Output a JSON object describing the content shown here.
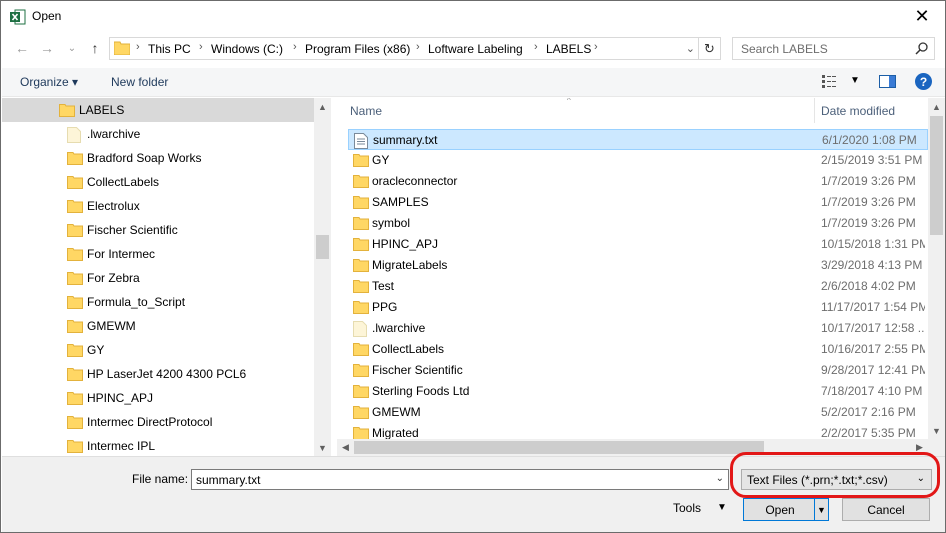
{
  "window": {
    "title": "Open",
    "app_icon": "excel-icon",
    "close_glyph": "✕"
  },
  "nav_buttons": {
    "back": "←",
    "forward": "→",
    "recent": "⌄",
    "up": "↑"
  },
  "address": {
    "crumbs": [
      "This PC",
      "Windows (C:)",
      "Program Files (x86)",
      "Loftware Labeling",
      "LABELS"
    ],
    "separator": "›",
    "refresh": "↻"
  },
  "search": {
    "placeholder": "Search LABELS"
  },
  "toolbar": {
    "organize": "Organize ▾",
    "new_folder": "New folder",
    "help": "?"
  },
  "nav_pane": {
    "items": [
      {
        "label": "LABELS",
        "icon": "folder-icon",
        "selected": true
      },
      {
        "label": ".lwarchive",
        "icon": "file-icon"
      },
      {
        "label": "Bradford Soap Works",
        "icon": "folder-icon"
      },
      {
        "label": "CollectLabels",
        "icon": "folder-icon"
      },
      {
        "label": "Electrolux",
        "icon": "folder-icon"
      },
      {
        "label": "Fischer Scientific",
        "icon": "folder-icon"
      },
      {
        "label": "For Intermec",
        "icon": "folder-icon"
      },
      {
        "label": "For Zebra",
        "icon": "folder-icon"
      },
      {
        "label": "Formula_to_Script",
        "icon": "folder-icon"
      },
      {
        "label": "GMEWM",
        "icon": "folder-icon"
      },
      {
        "label": "GY",
        "icon": "folder-icon"
      },
      {
        "label": "HP LaserJet 4200 4300 PCL6",
        "icon": "folder-icon"
      },
      {
        "label": "HPINC_APJ",
        "icon": "folder-icon"
      },
      {
        "label": "Intermec DirectProtocol",
        "icon": "folder-icon"
      },
      {
        "label": "Intermec IPL",
        "icon": "folder-icon"
      }
    ]
  },
  "file_list": {
    "columns": {
      "name": "Name",
      "date": "Date modified"
    },
    "rows": [
      {
        "name": "summary.txt",
        "date": "6/1/2020 1:08 PM",
        "icon": "text-file-icon",
        "selected": true
      },
      {
        "name": "GY",
        "date": "2/15/2019 3:51 PM",
        "icon": "folder-icon"
      },
      {
        "name": "oracleconnector",
        "date": "1/7/2019 3:26 PM",
        "icon": "folder-icon"
      },
      {
        "name": "SAMPLES",
        "date": "1/7/2019 3:26 PM",
        "icon": "folder-icon"
      },
      {
        "name": "symbol",
        "date": "1/7/2019 3:26 PM",
        "icon": "folder-icon"
      },
      {
        "name": "HPINC_APJ",
        "date": "10/15/2018 1:31 PM",
        "icon": "folder-icon"
      },
      {
        "name": "MigrateLabels",
        "date": "3/29/2018 4:13 PM",
        "icon": "folder-icon"
      },
      {
        "name": "Test",
        "date": "2/6/2018 4:02 PM",
        "icon": "folder-icon"
      },
      {
        "name": "PPG",
        "date": "11/17/2017 1:54 PM",
        "icon": "folder-icon"
      },
      {
        "name": ".lwarchive",
        "date": "10/17/2017 12:58 ...",
        "icon": "file-icon"
      },
      {
        "name": "CollectLabels",
        "date": "10/16/2017 2:55 PM",
        "icon": "folder-icon"
      },
      {
        "name": "Fischer Scientific",
        "date": "9/28/2017 12:41 PM",
        "icon": "folder-icon"
      },
      {
        "name": "Sterling Foods Ltd",
        "date": "7/18/2017 4:10 PM",
        "icon": "folder-icon"
      },
      {
        "name": "GMEWM",
        "date": "5/2/2017 2:16 PM",
        "icon": "folder-icon"
      },
      {
        "name": "Migrated",
        "date": "2/2/2017 5:35 PM",
        "icon": "folder-icon"
      }
    ]
  },
  "bottom": {
    "file_name_label": "File name:",
    "file_name_value": "summary.txt",
    "file_type_value": "Text Files (*.prn;*.txt;*.csv)",
    "tools_label": "Tools",
    "open_label": "Open",
    "cancel_label": "Cancel"
  },
  "colors": {
    "selection": "#cce8ff",
    "folder": "#ffd764",
    "highlight_ring": "#e21717",
    "accent": "#0078d7"
  }
}
